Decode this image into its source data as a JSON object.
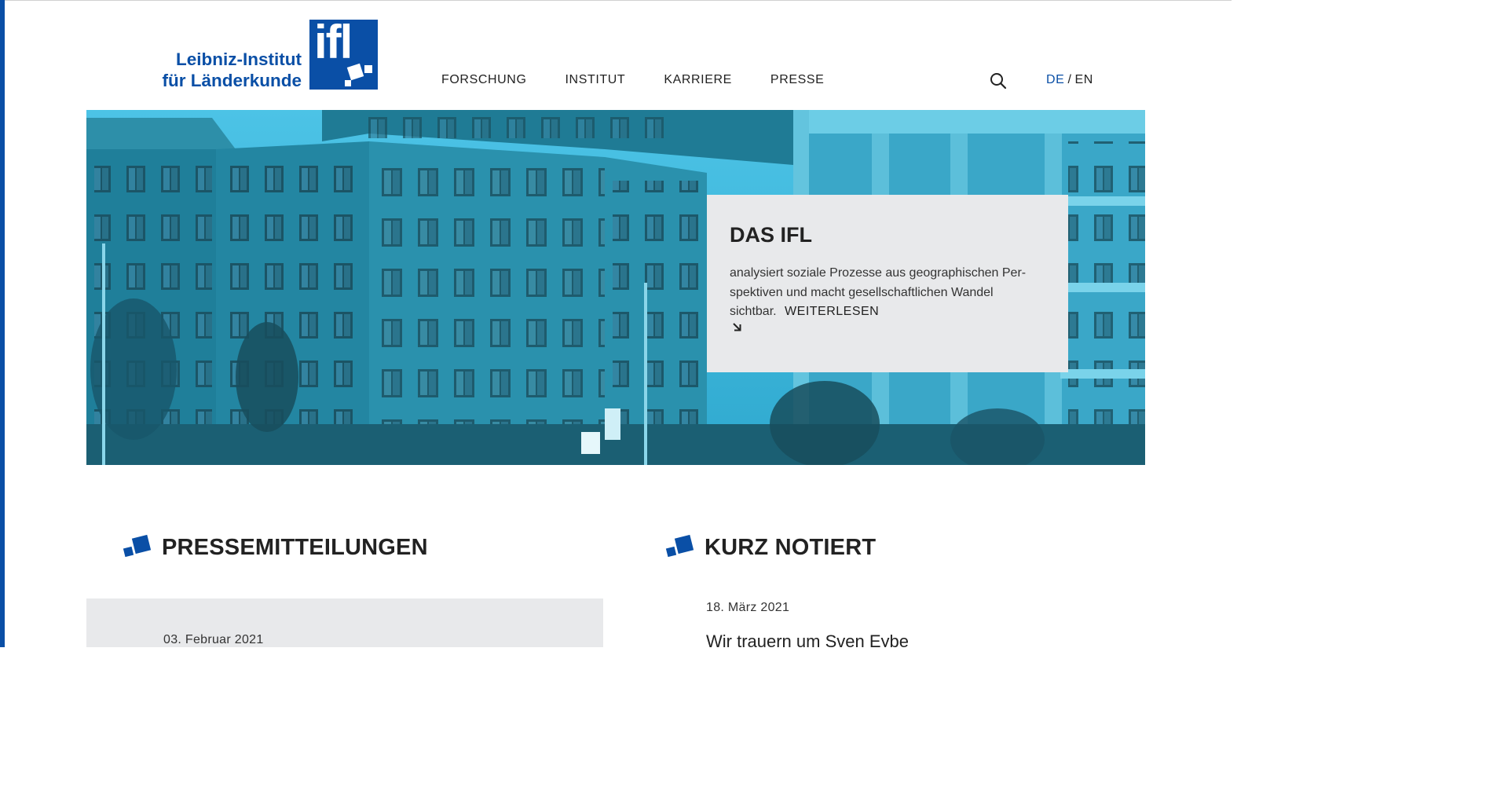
{
  "logo": {
    "line1": "Leibniz-Institut",
    "line2": "für Länderkunde",
    "mark": "ifl"
  },
  "nav": {
    "items": [
      {
        "label": "FORSCHUNG"
      },
      {
        "label": "INSTITUT"
      },
      {
        "label": "KARRIERE"
      },
      {
        "label": "PRESSE"
      }
    ]
  },
  "header": {
    "search_icon": "search-icon",
    "lang_active": "DE",
    "lang_separator": "/",
    "lang_other": "EN"
  },
  "hero": {
    "card_title": "DAS IFL",
    "card_text_line1": "analysiert soziale Prozesse aus geographischen Per-",
    "card_text_line2": "spektiven und macht gesellschaftlichen Wandel",
    "card_text_line3": "sichtbar.",
    "link_label": "WEITERLESEN",
    "link_icon": "arrow-down-right-icon",
    "photo_tint": "#2a9ab8"
  },
  "sections": {
    "press": {
      "title": "PRESSEMITTEILUNGEN",
      "items": [
        {
          "date": "03. Februar 2021"
        }
      ]
    },
    "news": {
      "title": "KURZ NOTIERT",
      "items": [
        {
          "date": "18. März 2021",
          "title": "Wir trauern um Sven Eybe"
        }
      ]
    }
  },
  "colors": {
    "brand_blue": "#0a4fa6",
    "card_bg": "#e8e9eb",
    "hero_tint": "#2a9ab8"
  }
}
